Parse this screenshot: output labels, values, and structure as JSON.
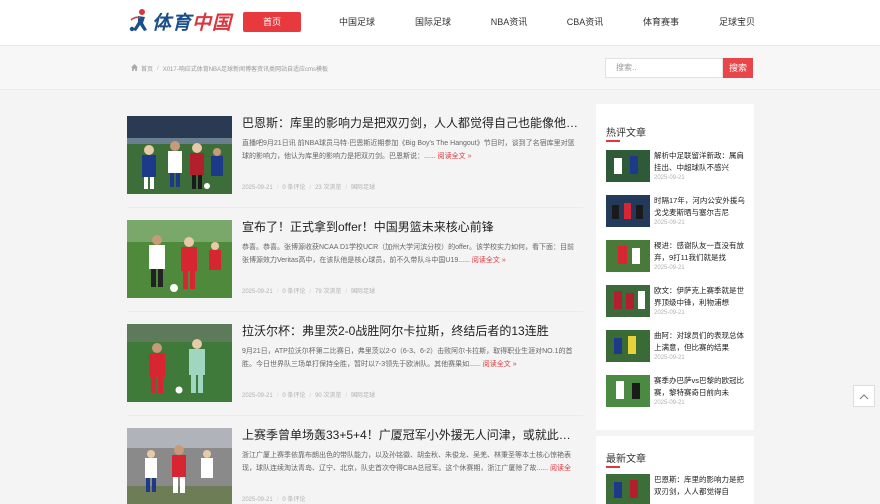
{
  "logo": {
    "text_main": "体育",
    "text_accent": "中国"
  },
  "nav": [
    {
      "label": "首页"
    },
    {
      "label": "中国足球"
    },
    {
      "label": "国际足球"
    },
    {
      "label": "NBA资讯"
    },
    {
      "label": "CBA资讯"
    },
    {
      "label": "体育赛事"
    },
    {
      "label": "足球宝贝"
    }
  ],
  "breadcrumb": {
    "home": "首页",
    "sep": "/",
    "current": "X017-响应式体育NBA足球新闻博客资讯类网站自适应cms模板"
  },
  "search": {
    "placeholder": "搜索..",
    "button": "搜索"
  },
  "articles": [
    {
      "title": "巴恩斯：库里的影响力是把双刃剑，人人都觉得自己也能像他那样",
      "summary": "直播吧9月21日讯 前NBA球员马特·巴恩斯近期参加《Big Boy's The Hangout》节目时，谈到了名宿库里对篮球的影响力，他认为库里的影响力是把双刃剑。巴恩斯说：......",
      "more": "阅读全文 »",
      "date": "2025-09-21",
      "comments": "0 条评论",
      "views": "23 次浏览",
      "category": "国际足球"
    },
    {
      "title": "宣布了！正式拿到offer！中国男篮未来核心前锋",
      "summary": "恭喜。恭喜。张博源收获NCAA D1学校UCR（加州大学河滨分校）的offer。该学校实力如何，看下面：目前张博源效力Veritas高中，在该队他是核心球员，前不久带队斗中国U19......",
      "more": "阅读全文 »",
      "date": "2025-09-21",
      "comments": "0 条评论",
      "views": "79 次浏览",
      "category": "国际足球"
    },
    {
      "title": "拉沃尔杯：弗里茨2-0战胜阿尔卡拉斯，终结后者的13连胜",
      "summary": "9月21日，ATP拉沃尔杯第二比赛日，弗里茨以2-0（6-3、6-2）击败阿尔卡拉斯，取得职业生涯对NO.1的首胜。今日世界队三场单打保持全胜，暂时以7-3领先于欧洲队。其他赛果如......",
      "more": "阅读全文 »",
      "date": "2025-09-21",
      "comments": "0 条评论",
      "views": "90 次浏览",
      "category": "国际足球"
    },
    {
      "title": "上赛季曾单场轰33+5+4！广厦冠军小外援无人问津，或就此告别……",
      "summary": "浙江广厦上赛季依靠布朗出色的带队能力，以及孙铭徽、胡金秋、朱俊龙、吴羌、林秉圣等本土核心惊艳表现，球队连续淘汰青岛、辽宁、北京，队史首次夺得CBA总冠军。这个休赛期，浙江广厦除了故......",
      "more": "阅读全文 »",
      "date": "2025-09-21",
      "comments": "0 条评论",
      "views": "",
      "category": ""
    }
  ],
  "sidebar": {
    "hot_title": "热评文章",
    "hot": [
      {
        "title": "解析中足联留洋新政：属肩挂出、中超球队不感兴趣……",
        "date": "2025-09-21"
      },
      {
        "title": "时隔17年，河内公安外援乌戈戈麦斯晒与塞尔吉尼奥……",
        "date": "2025-09-21"
      },
      {
        "title": "稷进：感谢队友一直没有放弃，9打11我们就是找着……",
        "date": "2025-09-21"
      },
      {
        "title": "欧文：伊萨克上赛季就是世界顶级中锋，利物浦想要……",
        "date": "2025-09-21"
      },
      {
        "title": "曲阿：对球员们的表现总体上满意，但比赛的结果并……",
        "date": "2025-09-21"
      },
      {
        "title": "赛季办巴萨vs巴黎的欧冠比赛，黎特赛奇日前向未婚……",
        "date": "2025-09-21"
      }
    ],
    "new_title": "最新文章",
    "new": [
      {
        "title": "巴恩斯：库里的影响力是把双刃剑，人人都觉得自己……",
        "date": "2025-09-21"
      }
    ]
  },
  "colors": {
    "accent": "#e83a3e",
    "logo_blue": "#1a4f8a"
  }
}
